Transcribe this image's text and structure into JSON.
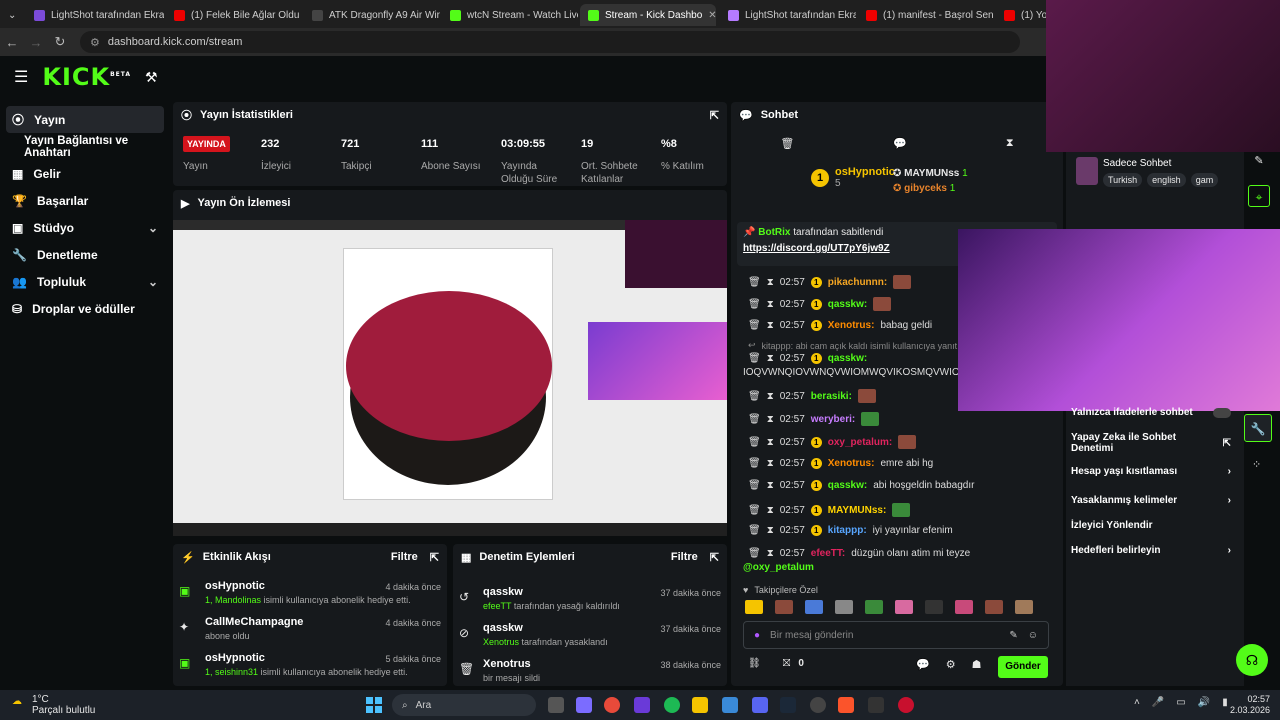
{
  "browser": {
    "tabs": [
      {
        "title": "LightShot tarafından Ekra",
        "active": false
      },
      {
        "title": "(1) Felek Bile Ağlar Oldu",
        "active": false
      },
      {
        "title": "ATK Dragonfly A9 Air Wir",
        "active": false
      },
      {
        "title": "wtcN Stream - Watch Live",
        "active": false
      },
      {
        "title": "Stream - Kick Dashbo",
        "active": true
      },
      {
        "title": "LightShot tarafından Ekra",
        "active": false
      },
      {
        "title": "(1) manifest - Başrol Sen",
        "active": false
      },
      {
        "title": "(1) YouT",
        "active": false
      }
    ],
    "url": "dashboard.kick.com/stream"
  },
  "app": {
    "logo": "KICK",
    "logo_sup": "BETA"
  },
  "sidebar": {
    "items": [
      {
        "label": "Yayın",
        "icon": "broadcast-icon"
      },
      {
        "label": "Yayın Bağlantısı ve Anahtarı",
        "icon": ""
      },
      {
        "label": "Gelir",
        "icon": "money-icon"
      },
      {
        "label": "Başarılar",
        "icon": "trophy-icon"
      },
      {
        "label": "Stüdyo",
        "icon": "studio-icon"
      },
      {
        "label": "Denetleme",
        "icon": "wrench-icon"
      },
      {
        "label": "Topluluk",
        "icon": "community-icon"
      },
      {
        "label": "Droplar ve ödüller",
        "icon": "drops-icon"
      }
    ]
  },
  "stats": {
    "title": "Yayın İstatistikleri",
    "live_badge": "YAYINDA",
    "live_label": "Yayın",
    "items": [
      {
        "value": "232",
        "label": "İzleyici"
      },
      {
        "value": "721",
        "label": "Takipçi"
      },
      {
        "value": "111",
        "label": "Abone Sayısı"
      },
      {
        "value": "03:09:55",
        "label": "Yayında Olduğu Süre"
      },
      {
        "value": "19",
        "label": "Ort. Sohbete Katılanlar"
      },
      {
        "value": "%8",
        "label": "% Katılım"
      }
    ]
  },
  "preview": {
    "title": "Yayın Ön İzlemesi"
  },
  "activity": {
    "title": "Etkinlik Akışı",
    "filter": "Filtre",
    "items": [
      {
        "name": "osHypnotic",
        "detail_user": "1, Mandolinas",
        "detail": " isimli kullanıcıya abonelik hediye etti.",
        "ago": "4 dakika önce"
      },
      {
        "name": "CallMeChampagne",
        "detail_user": "",
        "detail": "abone oldu",
        "ago": "4 dakika önce"
      },
      {
        "name": "osHypnotic",
        "detail_user": "1, seishinn31",
        "detail": " isimli kullanıcıya abonelik hediye etti.",
        "ago": "5 dakika önce"
      }
    ]
  },
  "moderation": {
    "title": "Denetim Eylemleri",
    "filter": "Filtre",
    "items": [
      {
        "name": "qasskw",
        "by": "efeeTT",
        "detail": " tarafından yasağı kaldırıldı",
        "ago": "37 dakika önce"
      },
      {
        "name": "qasskw",
        "by": "Xenotrus",
        "detail": " tarafından yasaklandı",
        "ago": "37 dakika önce"
      },
      {
        "name": "Xenotrus",
        "by": "",
        "detail": "bir mesajı sildi",
        "ago": "38 dakika önce"
      }
    ]
  },
  "chat": {
    "title": "Sohbet",
    "top_gifter": {
      "name": "osHypnotic",
      "count": "5"
    },
    "leaders": [
      {
        "name": "MAYMUNss",
        "count": "1"
      },
      {
        "name": "gibyceks",
        "count": "1"
      }
    ],
    "pinned_by": "BotRix",
    "pinned_label": "tarafından sabitlendi",
    "pinned_link": "https://discord.gg/UT7pY6jw9Z",
    "messages": [
      {
        "time": "02:57",
        "user": "pikachunnn:",
        "text": "",
        "color": "#f5a623"
      },
      {
        "time": "02:57",
        "user": "qasskw:",
        "text": "",
        "color": "#53fc18"
      },
      {
        "time": "02:57",
        "user": "Xenotrus:",
        "text": "babag geldi",
        "color": "#ff8c00"
      },
      {
        "time": "02:57",
        "user": "qasskw:",
        "text": "IOQVWNQIOVWNQVWIOMWQVIKOSMQVWIOKMVA",
        "color": "#53fc18"
      },
      {
        "time": "02:57",
        "user": "berasiki:",
        "text": "",
        "color": "#53fc18"
      },
      {
        "time": "02:57",
        "user": "weryberi:",
        "text": "",
        "color": "#c77dff"
      },
      {
        "time": "02:57",
        "user": "oxy_petalum:",
        "text": "",
        "color": "#e0245e"
      },
      {
        "time": "02:57",
        "user": "Xenotrus:",
        "text": "emre abi hg",
        "color": "#ff8c00"
      },
      {
        "time": "02:57",
        "user": "qasskw:",
        "text": "abi hoşgeldin babagdır",
        "color": "#53fc18"
      },
      {
        "time": "02:57",
        "user": "MAYMUNss:",
        "text": "",
        "color": "#ffd400"
      },
      {
        "time": "02:57",
        "user": "kitappp:",
        "text": "iyi yayınlar efenim",
        "color": "#58a6ff"
      },
      {
        "time": "02:57",
        "user": "efeeTT:",
        "text": "düzgün olanı atim mi teyze",
        "color": "#e0245e"
      }
    ],
    "reply_note": "kitappp: abi cam açık kaldı isimli kullanıcıya yanıt veriy",
    "mention": "@oxy_petalum",
    "followers_only": "Takipçilere Özel",
    "input_placeholder": "Bir mesaj gönderin",
    "points": "0",
    "send": "Gönder"
  },
  "settings": {
    "chat_only": "Sadece Sohbet",
    "tags": [
      "Turkish",
      "english",
      "gam"
    ],
    "rows": [
      "Yalnızca ifadelerle sohbet",
      "Yapay Zeka ile Sohbet Denetimi",
      "Hesap yaşı kısıtlaması",
      "Yasaklanmış kelimeler",
      "İzleyici Yönlendir",
      "Hedefleri belirleyin"
    ]
  },
  "taskbar": {
    "weather_temp": "1°C",
    "weather_desc": "Parçalı bulutlu",
    "search": "Ara",
    "time": "02:57",
    "date": "2.03.2026"
  },
  "colors": {
    "brand": "#53fc18",
    "live": "#d4141c"
  }
}
